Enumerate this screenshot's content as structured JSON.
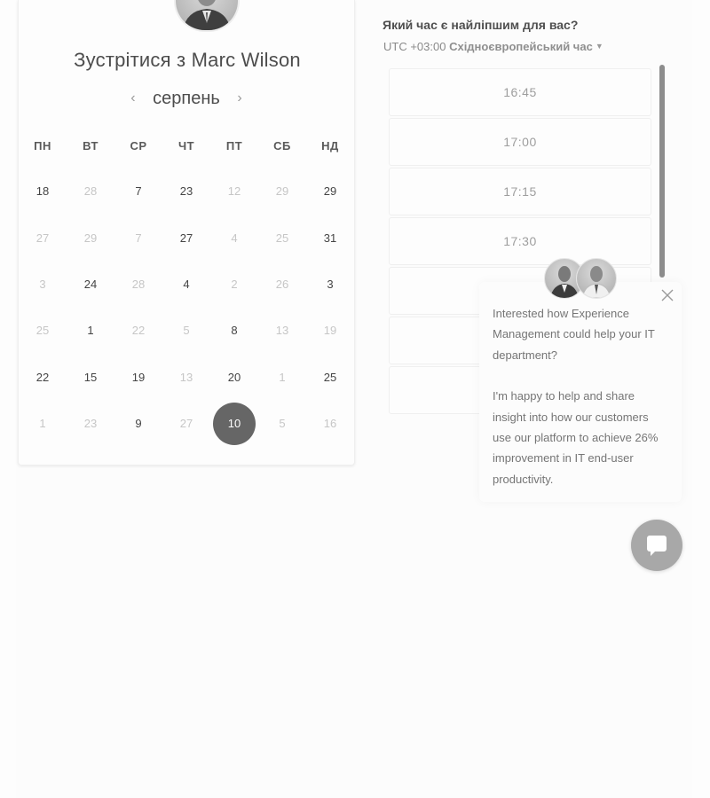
{
  "meeting": {
    "title": "Зустрітися з Marc Wilson",
    "month": "серпень",
    "prev_icon": "chevron-left-icon",
    "next_icon": "chevron-right-icon"
  },
  "calendar": {
    "weekdays": [
      "ПН",
      "ВТ",
      "СР",
      "ЧТ",
      "ПТ",
      "СБ",
      "НД"
    ],
    "weeks": [
      [
        {
          "d": "18",
          "a": true
        },
        {
          "d": "28",
          "a": false
        },
        {
          "d": "7",
          "a": true
        },
        {
          "d": "23",
          "a": true
        },
        {
          "d": "12",
          "a": false
        },
        {
          "d": "29",
          "a": false
        },
        {
          "d": "29",
          "a": true
        }
      ],
      [
        {
          "d": "27",
          "a": false
        },
        {
          "d": "29",
          "a": false
        },
        {
          "d": "7",
          "a": false
        },
        {
          "d": "27",
          "a": true
        },
        {
          "d": "4",
          "a": false
        },
        {
          "d": "25",
          "a": false
        },
        {
          "d": "31",
          "a": true
        }
      ],
      [
        {
          "d": "3",
          "a": false
        },
        {
          "d": "24",
          "a": true
        },
        {
          "d": "28",
          "a": false
        },
        {
          "d": "4",
          "a": true
        },
        {
          "d": "2",
          "a": false
        },
        {
          "d": "26",
          "a": false
        },
        {
          "d": "3",
          "a": true
        }
      ],
      [
        {
          "d": "25",
          "a": false
        },
        {
          "d": "1",
          "a": true
        },
        {
          "d": "22",
          "a": false
        },
        {
          "d": "5",
          "a": false
        },
        {
          "d": "8",
          "a": true
        },
        {
          "d": "13",
          "a": false
        },
        {
          "d": "19",
          "a": false
        }
      ],
      [
        {
          "d": "22",
          "a": true
        },
        {
          "d": "15",
          "a": true
        },
        {
          "d": "19",
          "a": true
        },
        {
          "d": "13",
          "a": false
        },
        {
          "d": "20",
          "a": true
        },
        {
          "d": "1",
          "a": false
        },
        {
          "d": "25",
          "a": true
        }
      ],
      [
        {
          "d": "1",
          "a": false
        },
        {
          "d": "23",
          "a": false
        },
        {
          "d": "9",
          "a": true
        },
        {
          "d": "27",
          "a": false
        },
        {
          "d": "10",
          "a": true,
          "selected": true
        },
        {
          "d": "5",
          "a": false
        },
        {
          "d": "16",
          "a": false
        }
      ]
    ]
  },
  "times": {
    "question": "Який час є найліпшим для вас?",
    "tz_offset": "UTC +03:00",
    "tz_name": "Східноєвропейський час",
    "slots": [
      "16:45",
      "17:00",
      "17:15",
      "17:30",
      "",
      "",
      ""
    ]
  },
  "chat": {
    "message_1": "Interested how Experience Management could help your IT department?",
    "message_2": "I'm happy to help and share insight into how our customers use our platform to achieve 26% improvement in IT end-user productivity.",
    "close_icon": "close-icon",
    "launcher_icon": "chat-bubble-icon"
  },
  "colors": {
    "selected_day": "#666666",
    "scrollbar": "#8d8d8d",
    "launcher": "#a8a8a8"
  }
}
